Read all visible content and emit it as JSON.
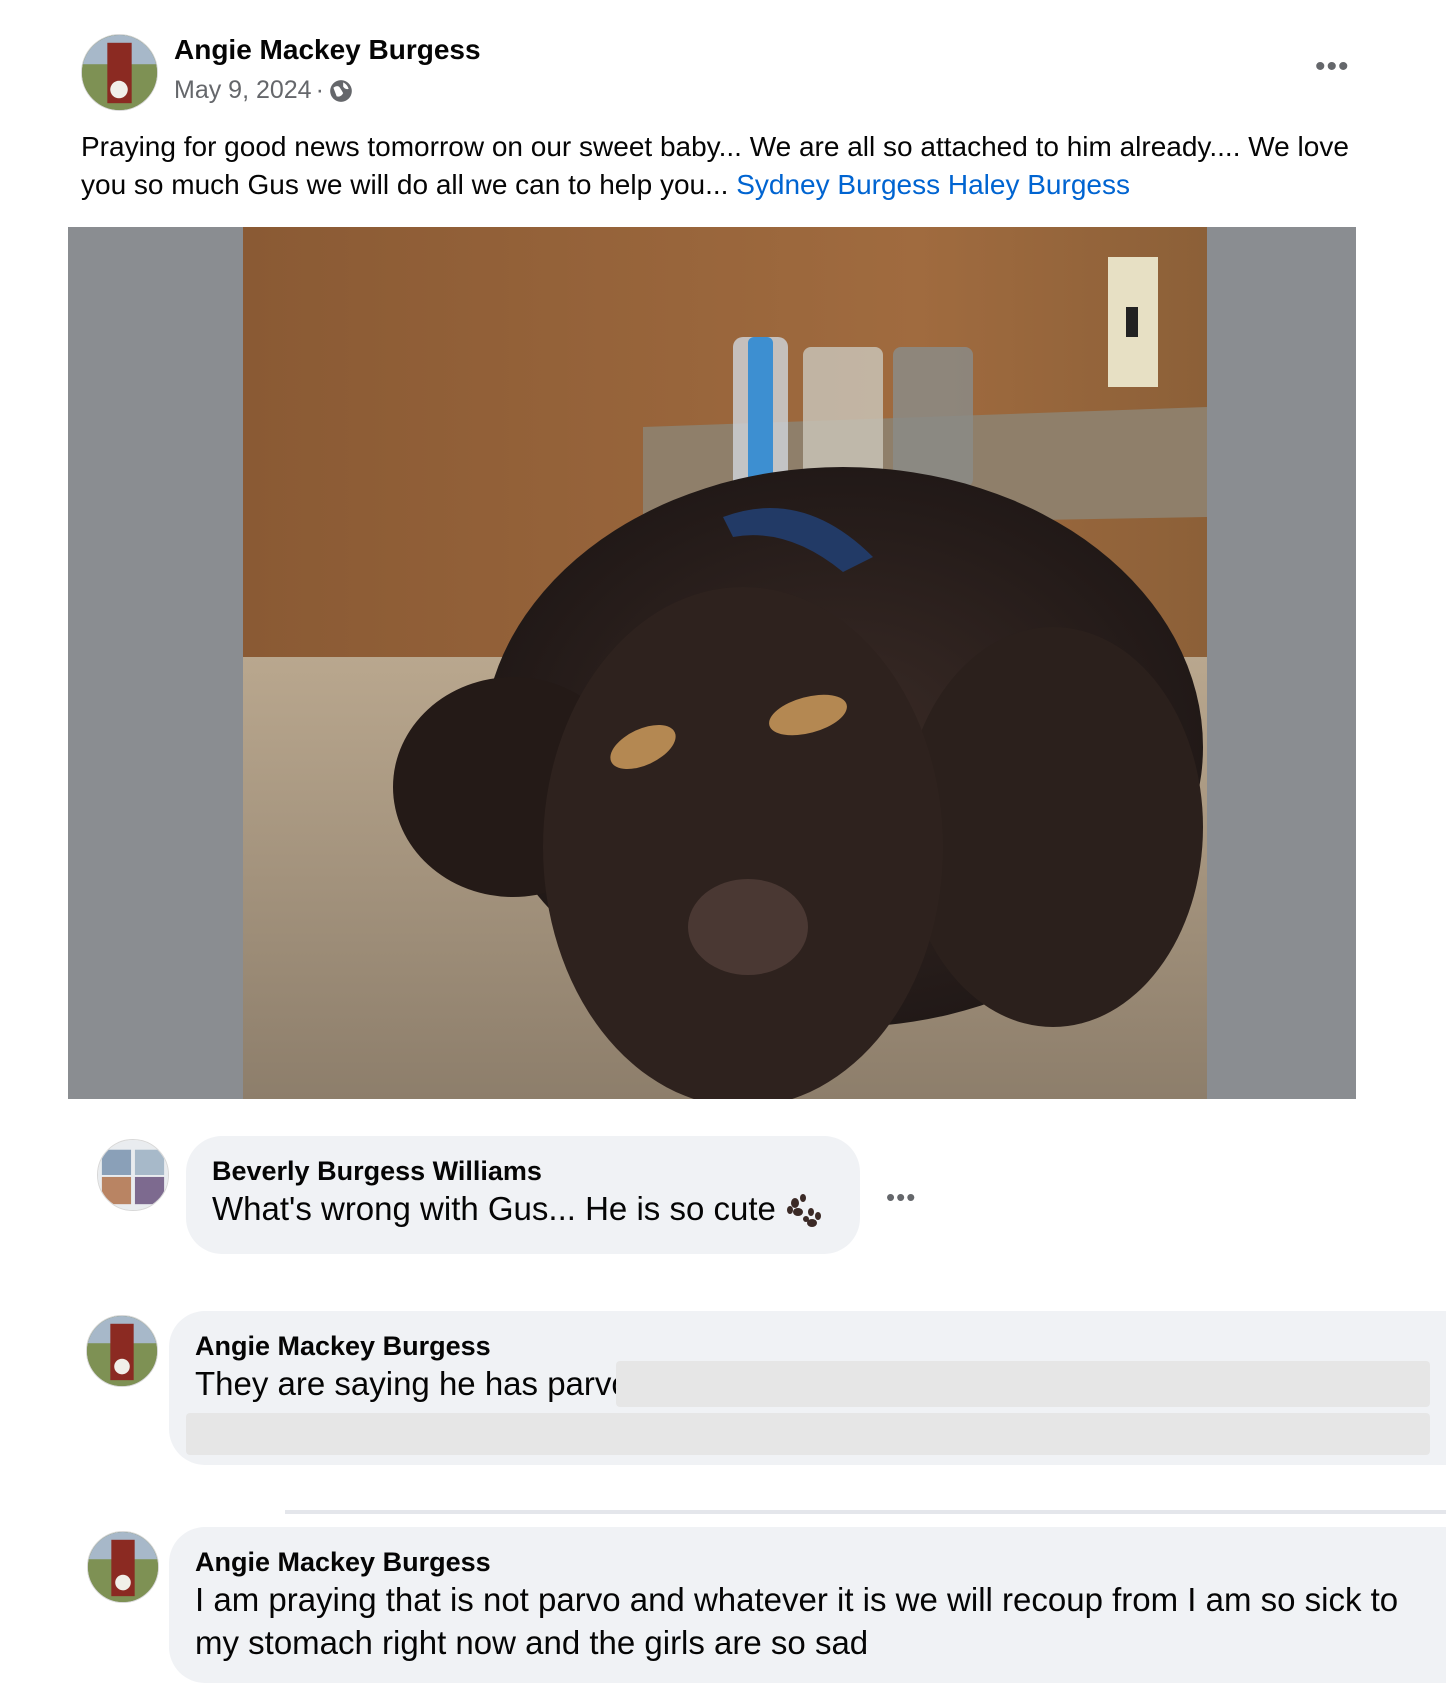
{
  "post": {
    "author": "Angie Mackey Burgess",
    "date": "May 9, 2024",
    "privacy_icon": "globe-icon",
    "text": "Praying for good news tomorrow on our sweet baby...  We are all so attached to him already....  We love you so much Gus we will do all we can to help you... ",
    "mentions": [
      "Sydney Burgess",
      "Haley Burgess"
    ],
    "more_icon": "more-horizontal-icon"
  },
  "comments": [
    {
      "author": "Beverly Burgess Williams",
      "text": "What's wrong with Gus... He is so cute",
      "emoji": "paw-prints-icon",
      "more_icon": "more-horizontal-icon"
    },
    {
      "author": "Angie Mackey Burgess",
      "text": "They are saying he has parvo,"
    },
    {
      "author": "Angie Mackey Burgess",
      "text": "I am praying that is not parvo and whatever it is we will recoup from I am so sick to my stomach right now and the girls are so sad"
    }
  ],
  "colors": {
    "link": "#0064d1",
    "bubble": "#f0f2f5",
    "media_background": "#8a8d91",
    "secondary_text": "#65676b"
  }
}
